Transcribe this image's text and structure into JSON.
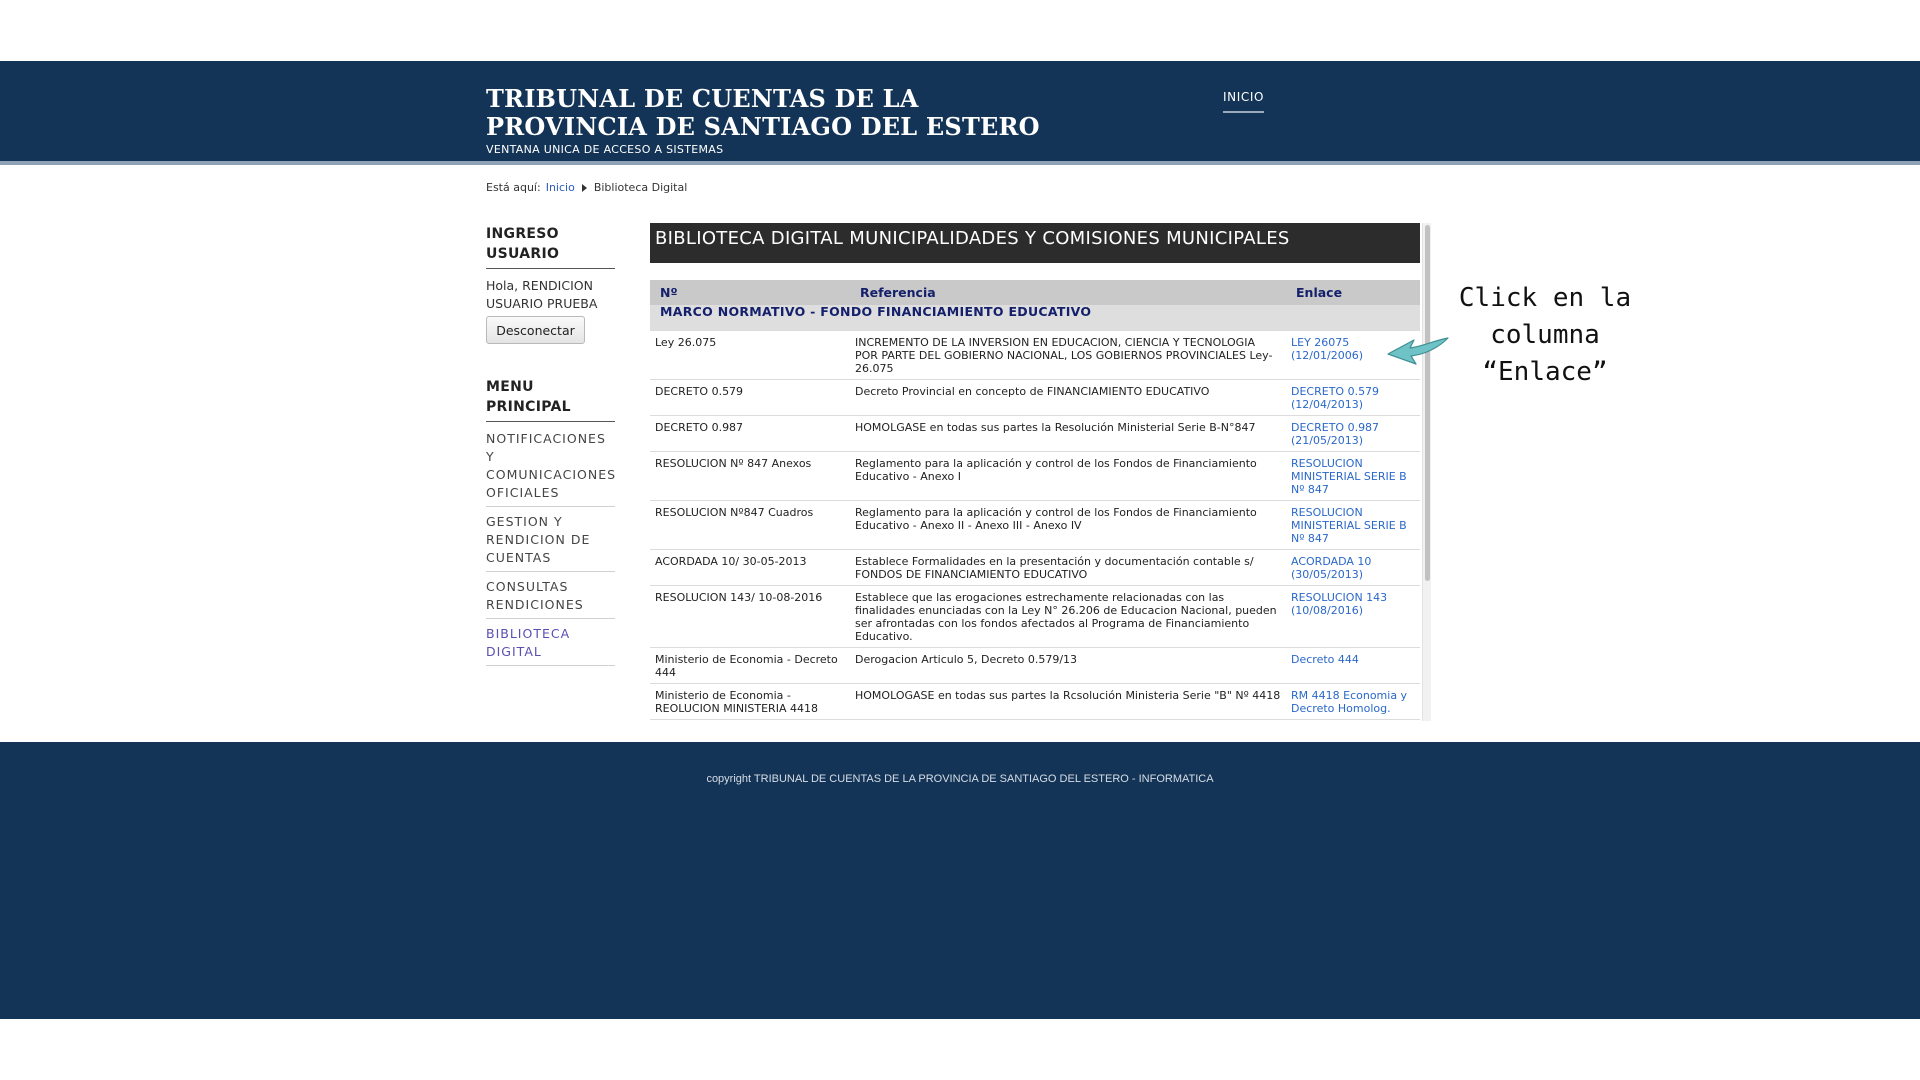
{
  "header": {
    "title": "TRIBUNAL DE CUENTAS DE LA PROVINCIA DE SANTIAGO DEL ESTERO",
    "subtitle": "VENTANA UNICA DE ACCESO A SISTEMAS",
    "nav": {
      "inicio": "INICIO"
    }
  },
  "breadcrumb": {
    "prefix": "Está aquí:",
    "home": "Inicio",
    "current": "Biblioteca Digital"
  },
  "sidebar": {
    "login_heading": "INGRESO USUARIO",
    "greeting": "Hola, RENDICION USUARIO PRUEBA",
    "logout_label": "Desconectar",
    "menu_heading": "MENU PRINCIPAL",
    "menu_items": [
      {
        "label": "NOTIFICACIONES Y COMUNICACIONES OFICIALES"
      },
      {
        "label": "GESTION Y RENDICION DE CUENTAS"
      },
      {
        "label": "CONSULTAS RENDICIONES"
      },
      {
        "label": "BIBLIOTECA DIGITAL"
      }
    ]
  },
  "main": {
    "title": "BIBLIOTECA DIGITAL MUNICIPALIDADES Y COMISIONES MUNICIPALES",
    "columns": {
      "no": "Nº",
      "ref": "Referencia",
      "link": "Enlace"
    },
    "section": "MARCO NORMATIVO - FONDO FINANCIAMIENTO EDUCATIVO",
    "rows": [
      {
        "no": "Ley 26.075",
        "ref": "INCREMENTO DE LA INVERSION EN EDUCACION, CIENCIA Y TECNOLOGIA POR PARTE DEL GOBIERNO NACIONAL, LOS GOBIERNOS PROVINCIALES Ley-26.075",
        "link": "LEY 26075 (12/01/2006)"
      },
      {
        "no": "DECRETO 0.579",
        "ref": "Decreto Provincial en concepto de FINANCIAMIENTO EDUCATIVO",
        "link": "DECRETO 0.579 (12/04/2013)"
      },
      {
        "no": "DECRETO 0.987",
        "ref": "HOMOLGASE en todas sus partes la Resolución Ministerial Serie B-N°847",
        "link": "DECRETO 0.987 (21/05/2013)"
      },
      {
        "no": "RESOLUCION Nº 847 Anexos",
        "ref": "Reglamento para la aplicación y control de los Fondos de Financiamiento Educativo - Anexo I",
        "link": "RESOLUCION MINISTERIAL SERIE B Nº 847"
      },
      {
        "no": "RESOLUCION Nº847 Cuadros",
        "ref": "Reglamento para la aplicación y control de los Fondos de Financiamiento Educativo - Anexo II - Anexo III - Anexo IV",
        "link": "RESOLUCION MINISTERIAL SERIE B Nº 847"
      },
      {
        "no": "ACORDADA 10/ 30-05-2013",
        "ref": "Establece Formalidades en la presentación y documentación contable s/ FONDOS DE FINANCIAMIENTO EDUCATIVO",
        "link": "ACORDADA 10 (30/05/2013)"
      },
      {
        "no": "RESOLUCION 143/ 10-08-2016",
        "ref": "Establece que las erogaciones estrechamente relacionadas con las finalidades enunciadas con la Ley N° 26.206 de Educacion Nacional, pueden ser afrontadas con los fondos afectados al Programa de Financiamiento Educativo.",
        "link": "RESOLUCION 143 (10/08/2016)"
      },
      {
        "no": "Ministerio de Economia - Decreto 444",
        "ref": "Derogacion Articulo 5, Decreto 0.579/13",
        "link": "Decreto 444"
      },
      {
        "no": "Ministerio de Economia - REOLUCION MINISTERIA 4418",
        "ref": "HOMOLOGASE en todas sus partes la Rcsolución Ministeria Serie \"B\" Nº 4418",
        "link": "RM 4418 Economia y Decreto Homolog."
      }
    ]
  },
  "annotation": {
    "text_line1": "Click en la",
    "text_line2": "columna",
    "text_line3": "“Enlace”",
    "arrow_color": "#6fc3c6"
  },
  "footer": {
    "copyright": "copyright TRIBUNAL DE CUENTAS DE LA PROVINCIA DE SANTIAGO DEL ESTERO - INFORMATICA"
  }
}
